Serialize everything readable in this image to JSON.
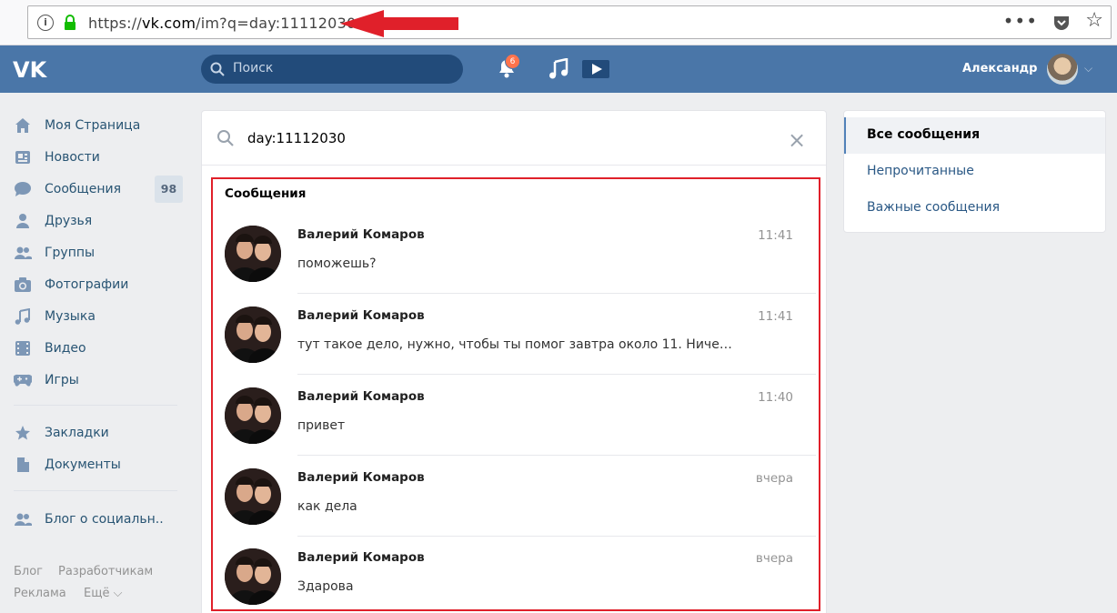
{
  "browser": {
    "url_prefix": "https://",
    "url_host": "vk.com",
    "url_path": "/im?q=day:11112030",
    "more_dots": "•••",
    "star": "☆"
  },
  "header": {
    "search_placeholder": "Поиск",
    "notifications_count": "6",
    "user_name": "Александр"
  },
  "sidebar": {
    "items": [
      {
        "label": "Моя Страница",
        "icon": "home-icon"
      },
      {
        "label": "Новости",
        "icon": "news-icon"
      },
      {
        "label": "Сообщения",
        "icon": "messages-icon",
        "count": "98"
      },
      {
        "label": "Друзья",
        "icon": "friends-icon"
      },
      {
        "label": "Группы",
        "icon": "groups-icon"
      },
      {
        "label": "Фотографии",
        "icon": "camera-icon"
      },
      {
        "label": "Музыка",
        "icon": "music-icon"
      },
      {
        "label": "Видео",
        "icon": "video-icon"
      },
      {
        "label": "Игры",
        "icon": "gamepad-icon"
      },
      {
        "label": "Закладки",
        "icon": "star-icon"
      },
      {
        "label": "Документы",
        "icon": "document-icon"
      },
      {
        "label": "Блог о социальн..",
        "icon": "blog-icon"
      }
    ],
    "footer": {
      "blog": "Блог",
      "developers": "Разработчикам",
      "ads": "Реклама",
      "more": "Ещё ⌵"
    }
  },
  "main": {
    "search_query": "day:11112030",
    "section_title": "Сообщения",
    "messages": [
      {
        "name": "Валерий Комаров",
        "time": "11:41",
        "text": "поможешь?"
      },
      {
        "name": "Валерий Комаров",
        "time": "11:41",
        "text": "тут такое дело, нужно, чтобы ты помог завтра около 11. Ничего сложного"
      },
      {
        "name": "Валерий Комаров",
        "time": "11:40",
        "text": "привет"
      },
      {
        "name": "Валерий Комаров",
        "time": "вчера",
        "text": "как дела"
      },
      {
        "name": "Валерий Комаров",
        "time": "вчера",
        "text": "Здарова"
      }
    ]
  },
  "rightmenu": {
    "items": [
      {
        "label": "Все сообщения",
        "active": true
      },
      {
        "label": "Непрочитанные",
        "active": false
      },
      {
        "label": "Важные сообщения",
        "active": false
      }
    ]
  },
  "colors": {
    "header_bg": "#4a76a8",
    "accent_link": "#2a5885",
    "annotation_red": "#e0202a"
  }
}
